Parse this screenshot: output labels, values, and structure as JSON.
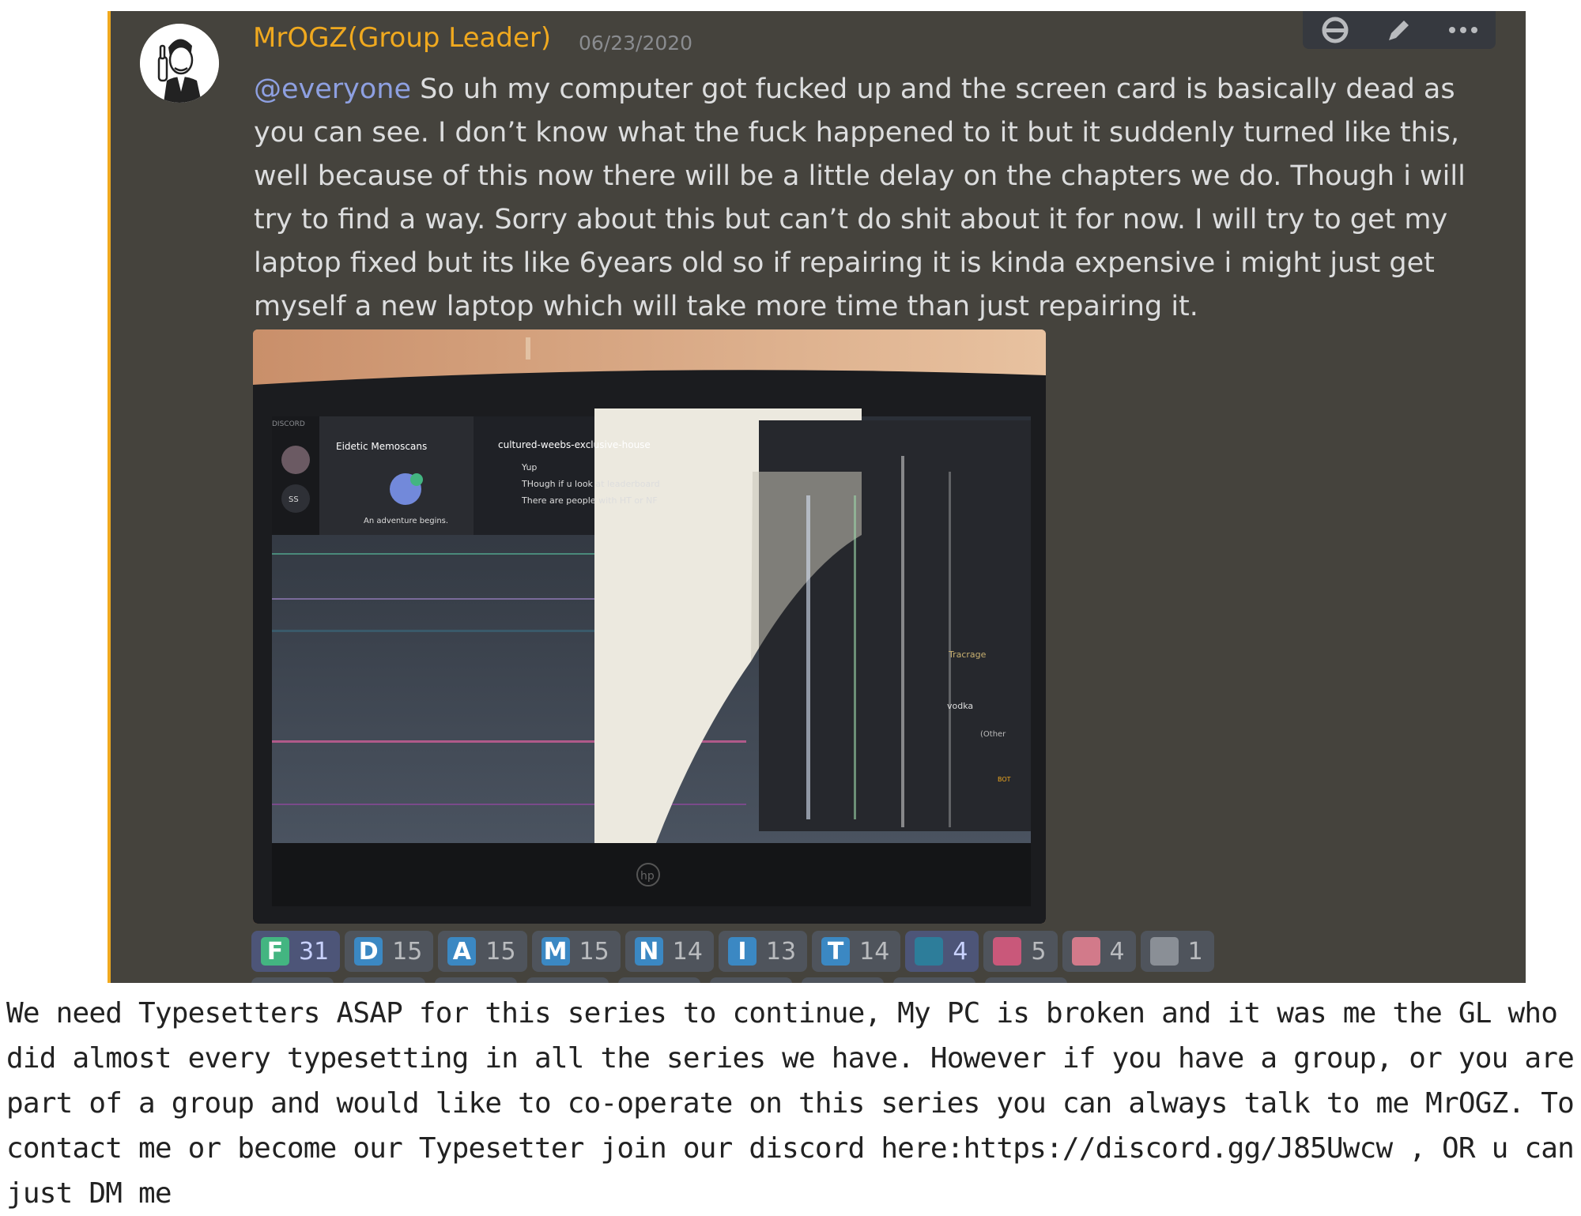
{
  "message": {
    "username": "MrOGZ(Group Leader)",
    "timestamp": "06/23/2020",
    "mention": "@everyone",
    "text": " So uh my computer got fucked up and the screen card is basically dead as you can see. I don’t know what the fuck happened to it but it suddenly turned like this, well because of this now there will be a little delay on the chapters we do. Though i will try to find a way. Sorry about this but can’t do shit about it for now. I will try to get my laptop fixed but its like 6years old so if repairing it is kinda expensive i might just get myself a new laptop which will take more time than just repairing it."
  },
  "attachment": {
    "brand": "hp",
    "discord_label": "DISCORD",
    "server_name": "Eidetic Memoscans",
    "server_initials": "SS",
    "server_caption": "An adventure begins.",
    "channel": "cultured-weebs-exclusive-house",
    "chat_lines": [
      "Yup",
      "THough if u look at leaderboard",
      "There are people with HT or NF"
    ],
    "members": [
      "Tracrage",
      "vodka",
      "(Other"
    ],
    "bot_tag": "BOT"
  },
  "reactions": [
    {
      "emoji": "pepe-f-icon",
      "label": "F",
      "count": "31",
      "color": "#43b581"
    },
    {
      "emoji": "letter-d-icon",
      "label": "D",
      "count": "15",
      "color": "#3b88c3"
    },
    {
      "emoji": "letter-a-icon",
      "label": "A",
      "count": "15",
      "color": "#3b88c3"
    },
    {
      "emoji": "letter-m-icon",
      "label": "M",
      "count": "15",
      "color": "#3b88c3"
    },
    {
      "emoji": "letter-n-icon",
      "label": "N",
      "count": "14",
      "color": "#3b88c3"
    },
    {
      "emoji": "letter-i-icon",
      "label": "I",
      "count": "13",
      "color": "#3b88c3"
    },
    {
      "emoji": "letter-t-icon",
      "label": "T",
      "count": "14",
      "color": "#3b88c3"
    },
    {
      "emoji": "island-icon",
      "label": "",
      "count": "4",
      "color": "#2d7d9a"
    },
    {
      "emoji": "anime-girl-icon",
      "label": "",
      "count": "5",
      "color": "#c9587a"
    },
    {
      "emoji": "anime-face-icon",
      "label": "",
      "count": "4",
      "color": "#d27a8a"
    },
    {
      "emoji": "moai-icon",
      "label": "",
      "count": "1",
      "color": "#8a8f96"
    }
  ],
  "footer": {
    "text": "We need Typesetters ASAP for this series to continue, My PC is broken and it was me the GL who did almost every typesetting in all the series we have. However if you have a group, or you are part of a group and would like to co-operate on this series you can always talk to me MrOGZ. To contact me or become our Typesetter join our discord here:https://discord.gg/J85Uwcw , OR u can just DM me"
  }
}
